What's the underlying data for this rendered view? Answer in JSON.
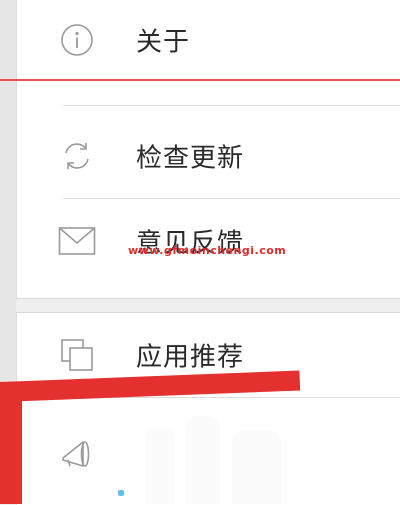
{
  "menu": {
    "group1": [
      {
        "label": "关于",
        "icon": "info-icon"
      },
      {
        "label": "检查更新",
        "icon": "refresh-icon"
      },
      {
        "label": "意见反馈",
        "icon": "mail-icon"
      }
    ],
    "group2": [
      {
        "label": "应用推荐",
        "icon": "copy-icon"
      },
      {
        "label": "",
        "icon": "megaphone-icon"
      }
    ]
  },
  "watermark": "www.gfmoinchengi.com",
  "colors": {
    "highlight_red": "#e4312f",
    "line_red": "#e8515a",
    "watermark_red": "#e02b2b",
    "icon_gray": "#9a9a9a",
    "text": "#2a2a2a"
  }
}
